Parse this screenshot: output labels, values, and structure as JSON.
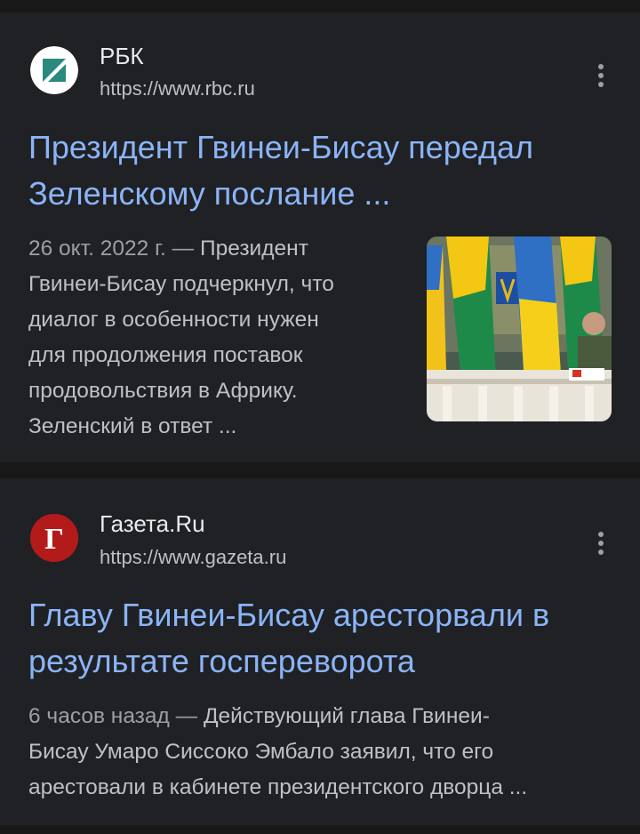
{
  "results": [
    {
      "site_name": "РБК",
      "url": "https://www.rbc.ru",
      "favicon_icon": "rbc-logo-icon",
      "title_line1": "Президент Гвинеи-Бисау передал",
      "title_line2": "Зеленскому послание ...",
      "date": "26 окт. 2022 г.",
      "dash": " — ",
      "snippet_line1_rest": "Президент",
      "snippet_lines": [
        "Гвинеи-Бисау подчеркнул, что",
        "диалог в особенности нужен",
        "для продолжения поставок",
        "продовольствия в Африку.",
        "Зеленский в ответ ..."
      ]
    },
    {
      "site_name": "Газета.Ru",
      "url": "https://www.gazeta.ru",
      "favicon_icon": "gazeta-logo-icon",
      "favicon_letter": "Г",
      "title_line1": "Главу Гвинеи-Бисау aресторвали в",
      "title_line2": "результате госпереворота",
      "date": "6 часов назад",
      "dash": " — ",
      "snippet_line1_rest": "Действующий глава Гвинеи-",
      "snippet_lines": [
        "Бисау Умаро Сиссоко Эмбало заявил, что его",
        "арестовали в кабинете президентского дворца ..."
      ]
    }
  ],
  "colors": {
    "title": "#8ab4f8",
    "snippet": "#bdc1c6",
    "card_bg": "#202124",
    "page_bg": "#181818"
  }
}
